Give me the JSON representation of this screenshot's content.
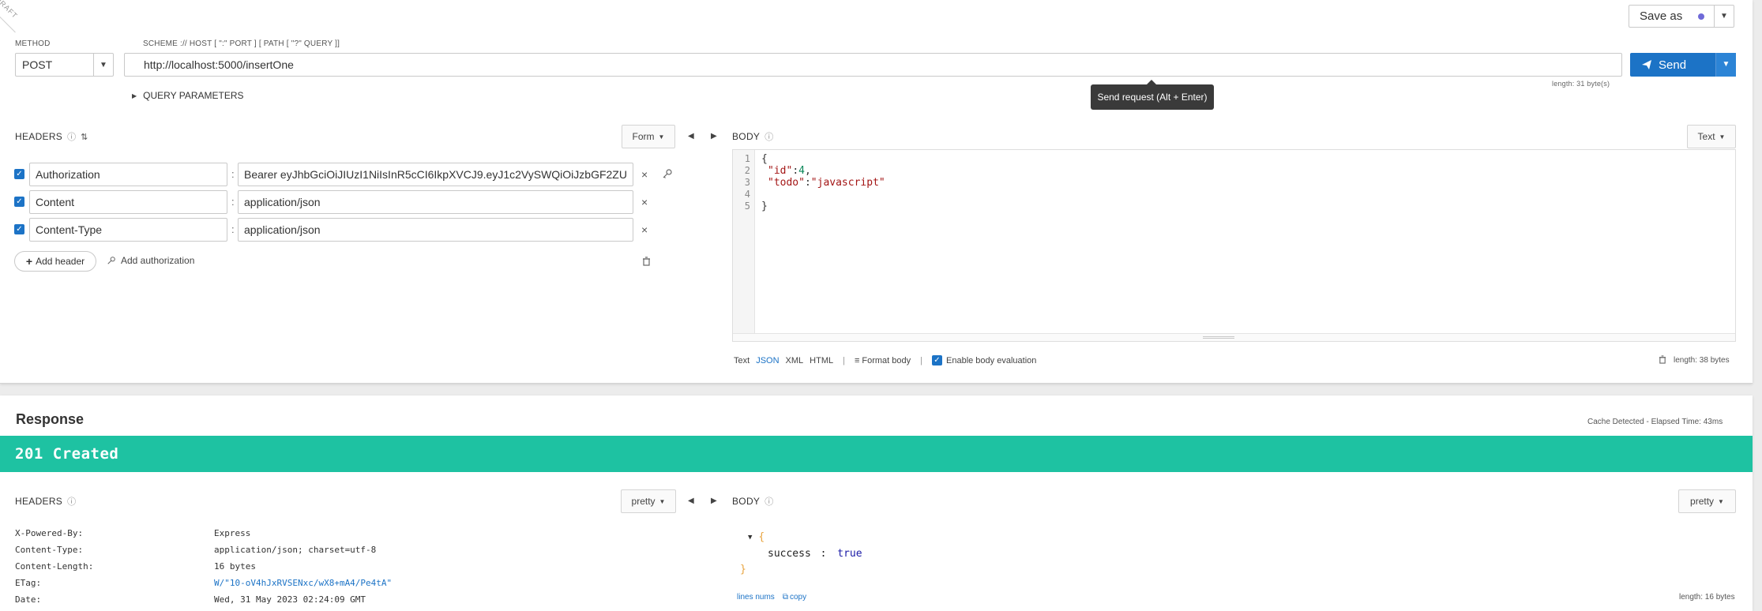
{
  "draft_label": "DRAFT",
  "request": {
    "method_label": "METHOD",
    "method_value": "POST",
    "url_hint": "SCHEME :// HOST [ \":\" PORT ] [ PATH [ \"?\" QUERY ]]",
    "url_value": "http://localhost:5000/insertOne",
    "save_as_label": "Save as",
    "send_label": "Send",
    "length_label": "length: 31 byte(s)",
    "tooltip": "Send request (Alt + Enter)",
    "query_params_label": "QUERY PARAMETERS",
    "headers": {
      "title": "HEADERS",
      "mode": "Form",
      "rows": [
        {
          "key": "Authorization",
          "value": "Bearer eyJhbGciOiJIUzI1NiIsInR5cCI6IkpXVCJ9.eyJ1c2VySWQiOiJzbGF2ZU"
        },
        {
          "key": "Content",
          "value": "application/json"
        },
        {
          "key": "Content-Type",
          "value": "application/json"
        }
      ],
      "add_header_label": "Add header",
      "add_auth_label": "Add authorization"
    },
    "body": {
      "title": "BODY",
      "mode": "Text",
      "lines": [
        {
          "no": "1",
          "text": "{"
        },
        {
          "no": "2",
          "key": "\"id\"",
          "val": "4",
          "tail": ","
        },
        {
          "no": "3",
          "key": "\"todo\"",
          "val": "\"javascript\""
        },
        {
          "no": "4",
          "text": ""
        },
        {
          "no": "5",
          "text": "}"
        }
      ],
      "formats": [
        "Text",
        "JSON",
        "XML",
        "HTML"
      ],
      "format_body_label": "Format body",
      "enable_eval_label": "Enable body evaluation",
      "length_label": "length: 38 bytes"
    }
  },
  "response": {
    "title": "Response",
    "meta": "Cache Detected - Elapsed Time: 43ms",
    "status": "201 Created",
    "headers": {
      "title": "HEADERS",
      "mode": "pretty",
      "rows": [
        {
          "key": "X-Powered-By:",
          "value": "Express"
        },
        {
          "key": "Content-Type:",
          "value": "application/json; charset=utf-8"
        },
        {
          "key": "Content-Length:",
          "value": "16 bytes"
        },
        {
          "key": "ETag:",
          "value": "W/\"10-oV4hJxRVSENxc/wX8+mA4/Pe4tA\""
        },
        {
          "key": "Date:",
          "value": "Wed, 31 May 2023 02:24:09 GMT"
        }
      ]
    },
    "body": {
      "title": "BODY",
      "mode": "pretty",
      "open_brace": "{",
      "key": "success",
      "sep": ":",
      "value": "true",
      "close_brace": "}",
      "lines_nums_label": "lines nums",
      "copy_label": "copy",
      "length_label": "length: 16 bytes"
    }
  },
  "colors": {
    "accent": "#1c73c6",
    "status_success": "#1ec2a2"
  }
}
